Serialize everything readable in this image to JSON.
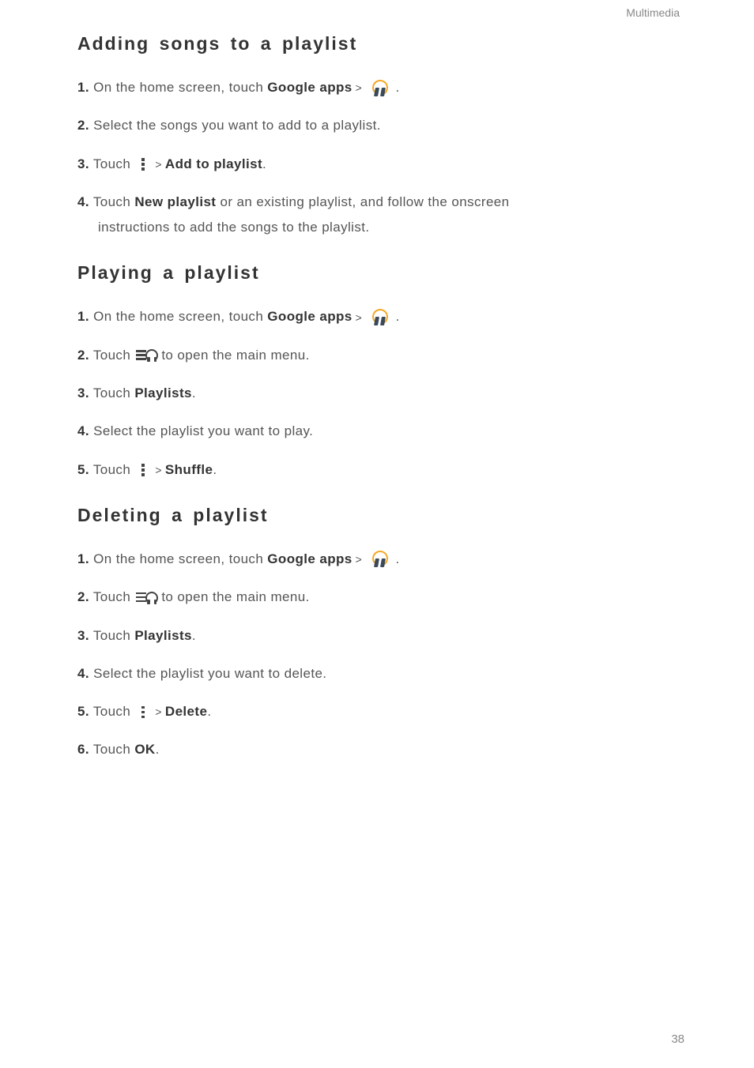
{
  "header": {
    "category": "Multimedia"
  },
  "page_number": "38",
  "sections": [
    {
      "id": "adding",
      "heading": "Adding songs to a playlist",
      "steps": [
        {
          "num": "1.",
          "pre": "On the home screen, touch ",
          "bold1": "Google apps",
          "icon": "headphones",
          "tail": " ."
        },
        {
          "num": "2.",
          "plain": "Select the songs you want to add to a playlist."
        },
        {
          "num": "3.",
          "pre": "Touch ",
          "icon": "more",
          "bold1": "Add to playlist",
          "tail": "."
        },
        {
          "num": "4.",
          "pre": "Touch ",
          "bold1": "New playlist",
          "mid": " or an existing playlist, and follow the onscreen ",
          "cont": "instructions to add the songs to the playlist."
        }
      ]
    },
    {
      "id": "playing",
      "heading": "Playing a playlist",
      "steps": [
        {
          "num": "1.",
          "pre": "On the home screen, touch ",
          "bold1": "Google apps",
          "icon": "headphones",
          "tail": " ."
        },
        {
          "num": "2.",
          "pre": "Touch ",
          "icon": "menuhp",
          "mid": "to open the main menu."
        },
        {
          "num": "3.",
          "pre": "Touch ",
          "bold1": "Playlists",
          "tail": "."
        },
        {
          "num": "4.",
          "plain": "Select the playlist you want to play."
        },
        {
          "num": "5.",
          "pre": "Touch ",
          "icon": "more",
          "bold1": "Shuffle",
          "tail": "."
        }
      ]
    },
    {
      "id": "deleting",
      "heading": "Deleting a playlist",
      "steps": [
        {
          "num": "1.",
          "pre": "On the home screen, touch ",
          "bold1": "Google apps",
          "icon": "headphones",
          "tail": " ."
        },
        {
          "num": "2.",
          "pre": "Touch ",
          "icon": "menuhp",
          "mid": "to open the main menu."
        },
        {
          "num": "3.",
          "pre": "Touch ",
          "bold1": "Playlists",
          "tail": "."
        },
        {
          "num": "4.",
          "plain": "Select the playlist you want to delete."
        },
        {
          "num": "5.",
          "pre": "Touch ",
          "icon": "more",
          "bold1": "Delete",
          "tail": "."
        },
        {
          "num": "6.",
          "pre": "Touch ",
          "bold1": "OK",
          "tail": "."
        }
      ]
    }
  ]
}
